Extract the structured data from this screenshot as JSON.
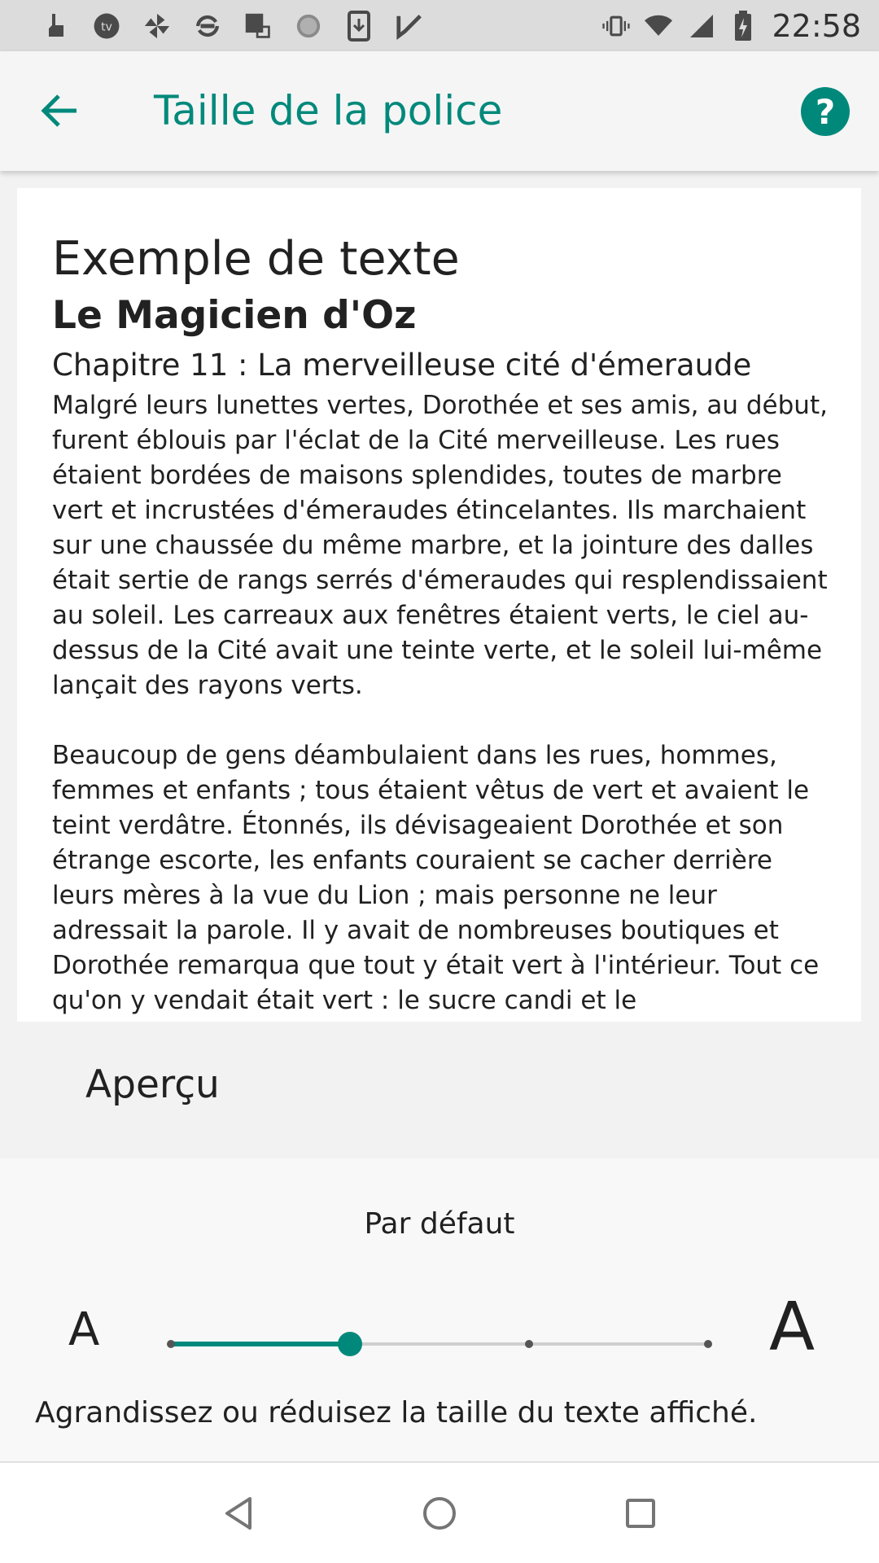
{
  "status_bar": {
    "time": "22:58",
    "left_icons": [
      "touch-icon",
      "tv-icon",
      "pinwheel-icon",
      "sync-icon",
      "tasks-icon",
      "loading-icon",
      "download-icon",
      "check-icon"
    ],
    "right_icons": [
      "vibrate-icon",
      "wifi-icon",
      "signal-icon",
      "battery-charging-icon"
    ]
  },
  "app_bar": {
    "title": "Taille de la police",
    "help_label": "?",
    "accent_color": "#00897b"
  },
  "preview": {
    "heading": "Exemple de texte",
    "book_title": "Le Magicien d'Oz",
    "chapter_title": "Chapitre 11 : La merveilleuse cité d'émeraude",
    "paragraphs": [
      "Malgré leurs lunettes vertes, Dorothée et ses amis, au début, furent éblouis par l'éclat de la Cité merveilleuse. Les rues étaient bordées de maisons splendides, toutes de marbre vert et incrustées d'émeraudes étincelantes. Ils marchaient sur une chaussée du même marbre, et la jointure des dalles était sertie de rangs serrés d'émeraudes qui resplendissaient au soleil. Les carreaux aux fenêtres étaient verts, le ciel au-dessus de la Cité avait une teinte verte, et le soleil lui-même lançait des rayons verts.",
      "Beaucoup de gens déambulaient dans les rues, hommes, femmes et enfants ; tous étaient vêtus de vert et avaient le teint verdâtre. Étonnés, ils dévisageaient Dorothée et son étrange escorte, les enfants couraient se cacher derrière leurs mères à la vue du Lion ; mais personne ne leur adressait la parole. Il y avait de nombreuses boutiques et Dorothée remarqua que tout y était vert à l'intérieur. Tout ce qu'on y vendait était vert : le sucre candi et le"
    ],
    "label": "Aperçu"
  },
  "font_size": {
    "current_label": "Par défaut",
    "small_label": "A",
    "large_label": "A",
    "steps": 4,
    "selected_index": 1,
    "description": "Agrandissez ou réduisez la taille du texte affiché."
  },
  "nav_bar": {
    "buttons": [
      "back-icon",
      "home-icon",
      "recents-icon"
    ]
  }
}
